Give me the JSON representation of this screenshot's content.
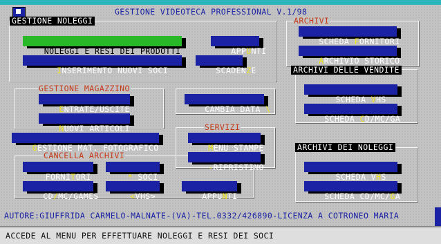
{
  "window": {
    "title": "GESTIONE VIDEOTECA PROFESSIONAL V.1/98"
  },
  "sections": {
    "noleggi": "GESTIONE NOLEGGI",
    "archivi": "ARCHIVI",
    "archivi_vendite": "ARCHIVI DELLE VENDITE",
    "archivi_noleggi": "ARCHIVI DEI NOLEGGI",
    "magazzino": "GESTIONE MAGAZZINO",
    "servizi": "SERVIZI",
    "cancella": "CANCELLA ARCHIVI"
  },
  "buttons": {
    "noleggi_resi": {
      "label": "NOLEGGI E RESI DEI PRODOTTI",
      "pre": "NOLEGGI E RESI DEI PRODOTTI",
      "hk": "",
      "post": ""
    },
    "appunti_top": {
      "pre": "APP",
      "hk": "U",
      "post": "NTI"
    },
    "inserimento_soci": {
      "pre": "",
      "hk": "I",
      "post": "NSERIMENTO NUOVI SOCI"
    },
    "scadenze": {
      "pre": "SCADEN",
      "hk": "Z",
      "post": "E"
    },
    "entrate_uscite": {
      "pre": "",
      "hk": "E",
      "post": "NTRATE/USCITE"
    },
    "nuovi_articoli": {
      "pre": "",
      "hk": "N",
      "post": "UOVI ARTICOLI"
    },
    "cambia_data": {
      "pre": "CAMBIA DATA ",
      "hk": "\\",
      "post": ""
    },
    "gestione_foto": {
      "pre": "",
      "hk": "G",
      "post": "ESTIONE MAT. FOTOGRAFICO"
    },
    "menu_stampe": {
      "pre": "",
      "hk": "M",
      "post": "ENU STAMPE"
    },
    "ripristino": {
      "pre": "",
      "hk": "-",
      "post": "RIPRISTINO"
    },
    "fornitori": {
      "pre": "FORNI",
      "hk": "T",
      "post": "ORI"
    },
    "soci": {
      "pre": "",
      "hk": "*",
      "post": " SOCI"
    },
    "cd_mc_games": {
      "pre": "CD",
      "hk": "/",
      "post": "MC/GAMES"
    },
    "vhs_del": {
      "pre": "",
      "hk": "<",
      "post": "VHS>"
    },
    "appunti_bottom": {
      "pre": "APPU",
      "hk": "N",
      "post": "TI"
    },
    "scheda_fornitori": {
      "pre": "SCHEDA ",
      "hk": "F",
      "post": "ORNITORI"
    },
    "archivio_storico": {
      "pre": "",
      "hk": "A",
      "post": "RCHIVIO STORICO"
    },
    "scheda_vhs_vend": {
      "pre": "SCHEDA ",
      "hk": "V",
      "post": "HS"
    },
    "scheda_cd_vend": {
      "pre": "SCHEDA ",
      "hk": "C",
      "post": "D/MC/GA"
    },
    "scheda_vhs_nol": {
      "pre": "SCHEDA V",
      "hk": "H",
      "post": "S"
    },
    "scheda_cd_nol": {
      "pre": "SCHEDA CD/MC/",
      "hk": "G",
      "post": "A"
    }
  },
  "author_line": "AUTORE:GIUFFRIDA CARMELO-MALNATE-(VA)-TEL.0332/426890-LICENZA A COTRONEO MARIA",
  "status_bar": "ACCEDE AL MENU PER EFFETTUARE NOLEGGI E RESI DEI SOCI",
  "colors": {
    "button_blue": "#1b22a4",
    "button_selected": "#28b828",
    "hotkey": "#f0e61c",
    "section_label": "#c63a18"
  }
}
